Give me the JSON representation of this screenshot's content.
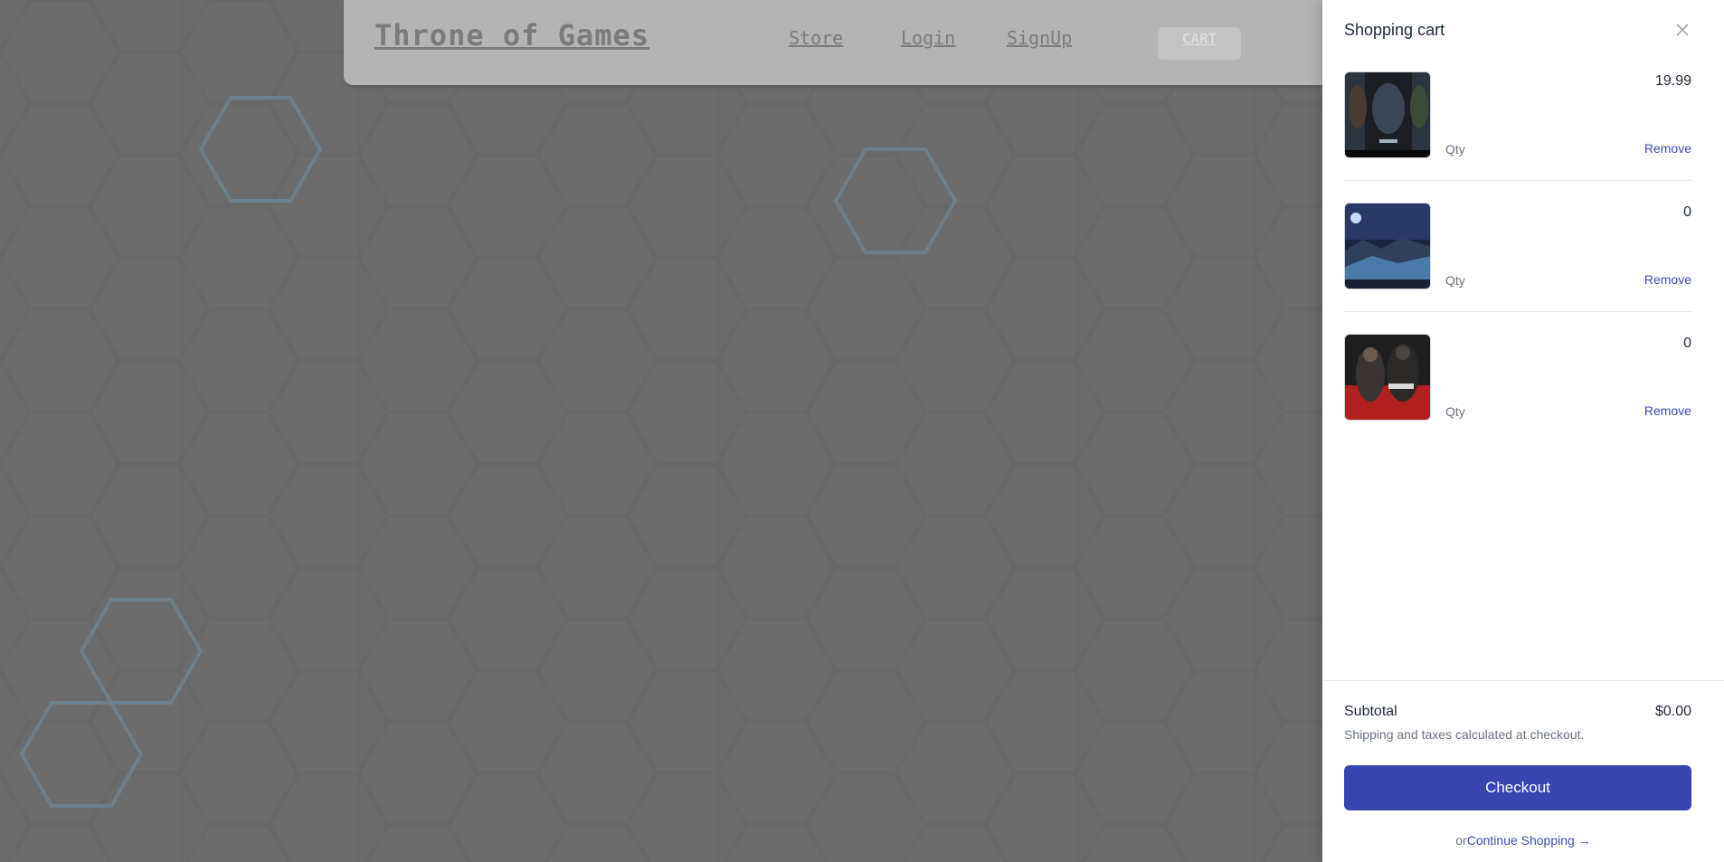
{
  "header": {
    "brand": "Throne of Games",
    "nav": {
      "store": "Store",
      "login": "Login",
      "signup": "SignUp",
      "cart": "CART"
    }
  },
  "cart": {
    "title": "Shopping cart",
    "items": [
      {
        "price": "19.99",
        "qty_label": "Qty",
        "remove_label": "Remove"
      },
      {
        "price": "0",
        "qty_label": "Qty",
        "remove_label": "Remove"
      },
      {
        "price": "0",
        "qty_label": "Qty",
        "remove_label": "Remove"
      }
    ],
    "subtotal_label": "Subtotal",
    "subtotal_value": "$0.00",
    "shipping_note": "Shipping and taxes calculated at checkout.",
    "checkout_label": "Checkout",
    "continue_prefix": "or",
    "continue_label": "Continue Shopping →"
  },
  "colors": {
    "accent": "#3a45b0",
    "link": "#3b4bb4",
    "overlay": "#808080"
  },
  "icons": [
    "close-icon"
  ]
}
